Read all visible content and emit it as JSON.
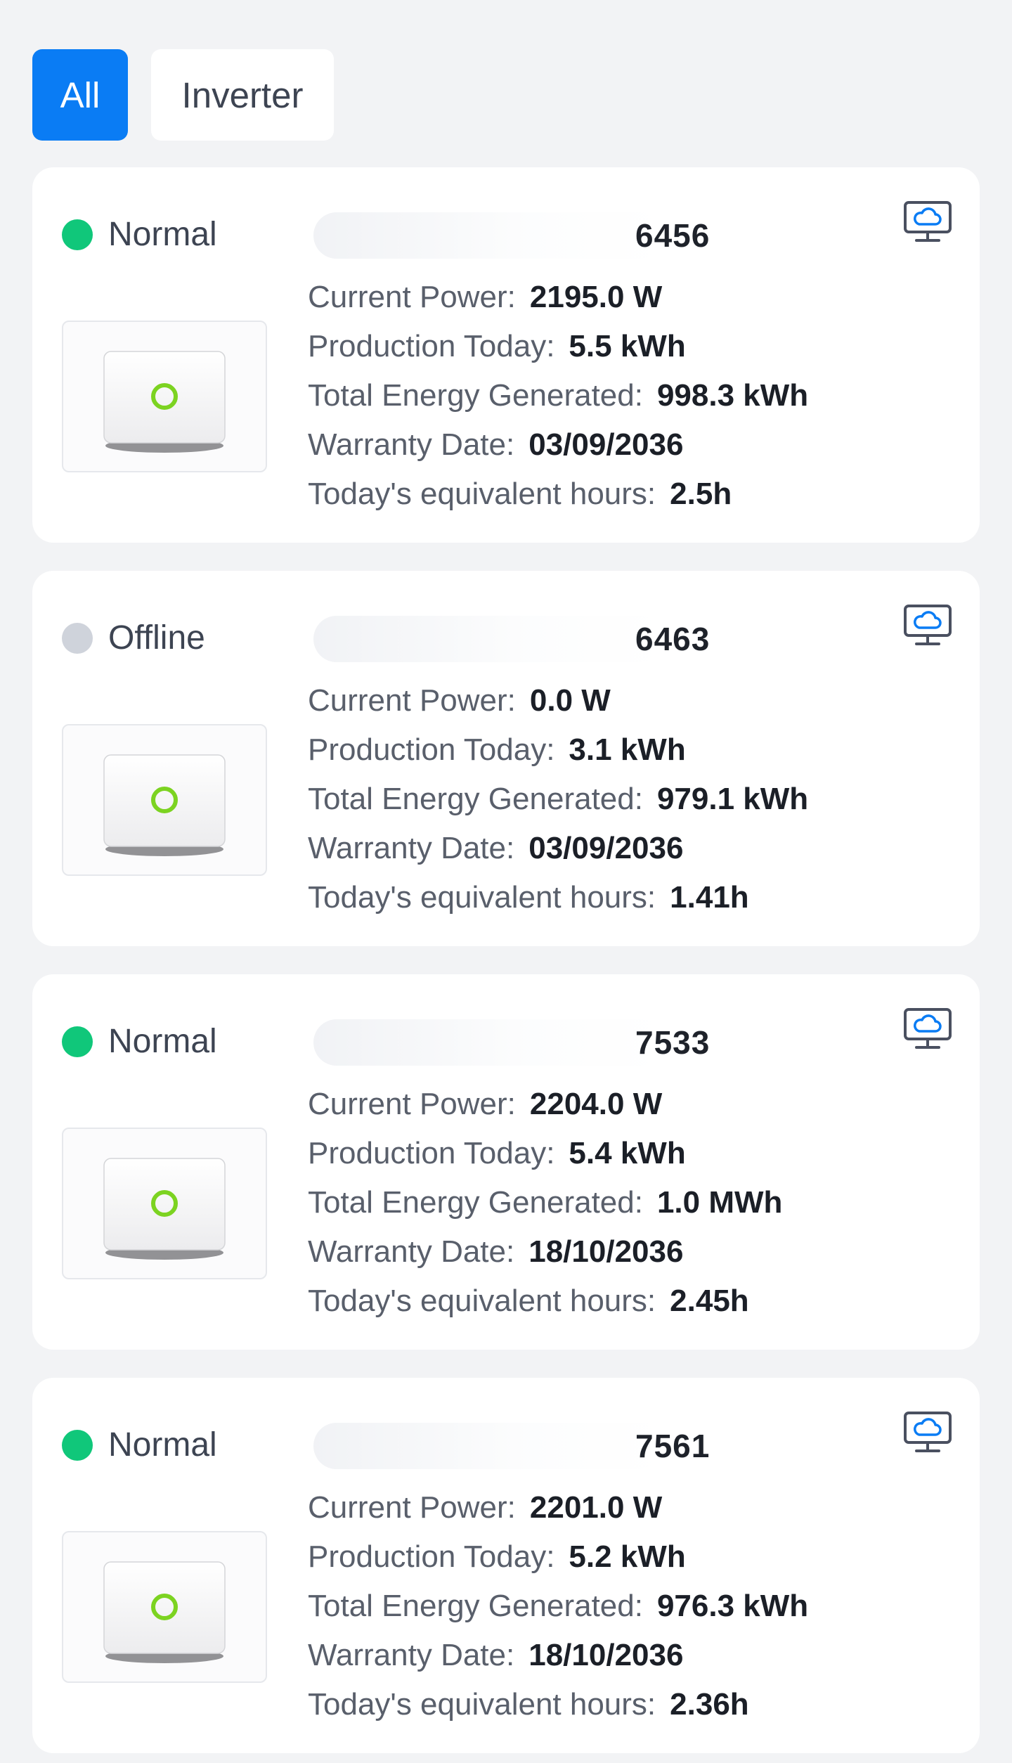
{
  "tabs": [
    {
      "label": "All",
      "active": true
    },
    {
      "label": "Inverter",
      "active": false
    }
  ],
  "colors": {
    "accent": "#0a7cf4",
    "normal": "#10c77a",
    "offline": "#cfd3db",
    "monitor_icon": "#0a7cf4"
  },
  "labels": {
    "current_power": "Current Power:",
    "production_today": "Production Today:",
    "total_energy": "Total Energy Generated:",
    "warranty_date": "Warranty Date:",
    "equivalent_hours": "Today's equivalent hours:"
  },
  "icons": {
    "status": "status-dot-icon",
    "monitor": "cloud-monitor-icon",
    "device": "inverter-device-icon"
  },
  "devices": [
    {
      "status": "Normal",
      "status_color": "#10c77a",
      "title_suffix": "6456",
      "current_power": "2195.0 W",
      "production_today": "5.5 kWh",
      "total_energy": "998.3 kWh",
      "warranty_date": "03/09/2036",
      "equivalent_hours": "2.5h"
    },
    {
      "status": "Offline",
      "status_color": "#cfd3db",
      "title_suffix": "6463",
      "current_power": "0.0 W",
      "production_today": "3.1 kWh",
      "total_energy": "979.1 kWh",
      "warranty_date": "03/09/2036",
      "equivalent_hours": "1.41h"
    },
    {
      "status": "Normal",
      "status_color": "#10c77a",
      "title_suffix": "7533",
      "current_power": "2204.0 W",
      "production_today": "5.4 kWh",
      "total_energy": "1.0 MWh",
      "warranty_date": "18/10/2036",
      "equivalent_hours": "2.45h"
    },
    {
      "status": "Normal",
      "status_color": "#10c77a",
      "title_suffix": "7561",
      "current_power": "2201.0 W",
      "production_today": "5.2 kWh",
      "total_energy": "976.3 kWh",
      "warranty_date": "18/10/2036",
      "equivalent_hours": "2.36h"
    }
  ]
}
